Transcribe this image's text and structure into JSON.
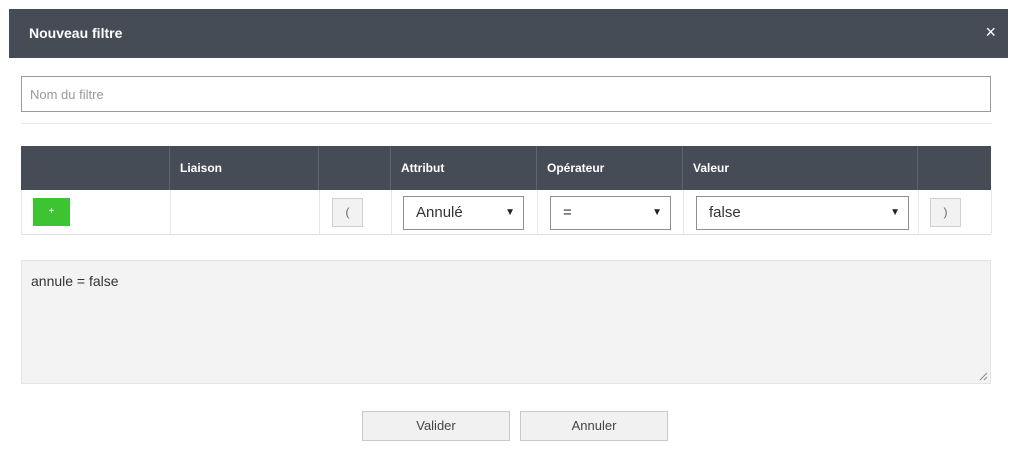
{
  "dialog": {
    "title": "Nouveau filtre",
    "close_glyph": "×"
  },
  "name_field": {
    "placeholder": "Nom du filtre",
    "value": ""
  },
  "table": {
    "headers": [
      "",
      "Liaison",
      "",
      "Attribut",
      "Opérateur",
      "Valeur",
      ""
    ],
    "row": {
      "add_label": "+",
      "liaison": "",
      "open_paren": "(",
      "attribut": "Annulé",
      "operateur": "=",
      "valeur": "false",
      "close_paren": ")"
    },
    "caret_glyph": "▼"
  },
  "expression": {
    "value": "annule = false"
  },
  "buttons": {
    "validate": "Valider",
    "cancel": "Annuler"
  },
  "colors": {
    "header_bg": "#464c55",
    "add_button": "#3ec333",
    "expression_bg": "#f3f3f3"
  }
}
